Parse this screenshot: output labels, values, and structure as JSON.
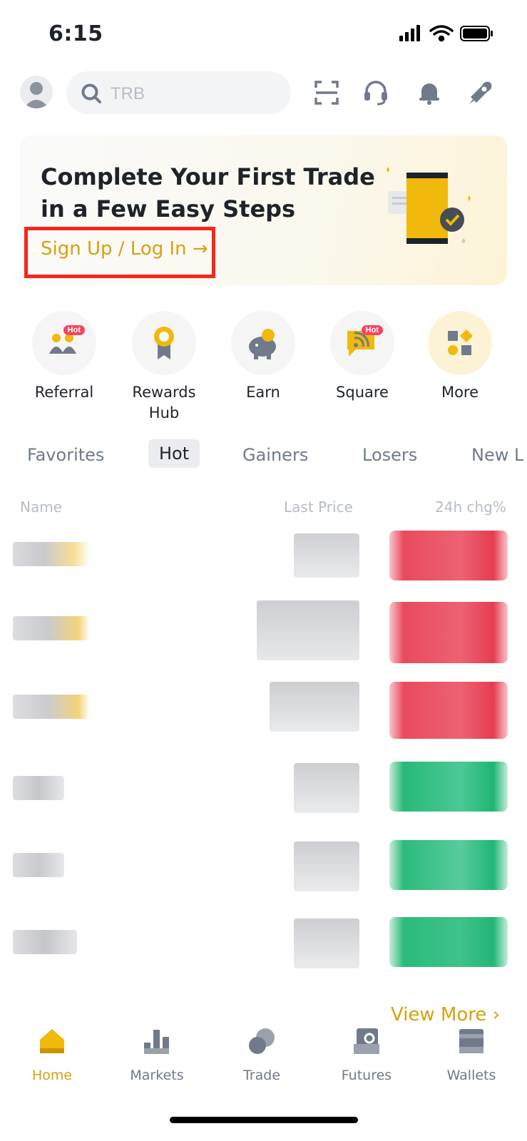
{
  "status": {
    "time": "6:15"
  },
  "header": {
    "search_placeholder": "TRB"
  },
  "banner": {
    "title": "Complete Your First Trade in a Few Easy Steps",
    "cta": "Sign Up / Log In →"
  },
  "shortcuts": [
    {
      "label": "Referral",
      "badge": "Hot"
    },
    {
      "label": "Rewards Hub"
    },
    {
      "label": "Earn"
    },
    {
      "label": "Square",
      "badge": "Hot"
    },
    {
      "label": "More"
    }
  ],
  "tabs": [
    "Favorites",
    "Hot",
    "Gainers",
    "Losers",
    "New L"
  ],
  "table": {
    "col_name": "Name",
    "col_price": "Last Price",
    "col_change": "24h chg%"
  },
  "view_more": "View More ›",
  "bottom_nav": [
    "Home",
    "Markets",
    "Trade",
    "Futures",
    "Wallets"
  ],
  "colors": {
    "accent": "#d8a00e",
    "down": "#f6465d",
    "up": "#2ebd85"
  }
}
